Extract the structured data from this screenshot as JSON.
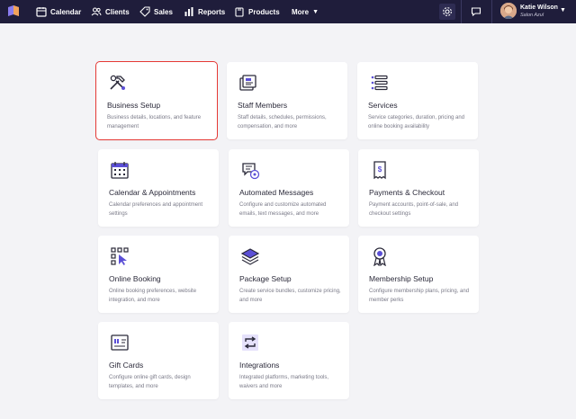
{
  "nav": {
    "calendar": "Calendar",
    "clients": "Clients",
    "sales": "Sales",
    "reports": "Reports",
    "products": "Products",
    "more": "More"
  },
  "user": {
    "name": "Katie Wilson",
    "business": "Salon Azul"
  },
  "colors": {
    "topbar": "#1f1d3b",
    "selected_outline": "#e53935",
    "accent": "#5b4fd6"
  },
  "cards": [
    {
      "title": "Business Setup",
      "desc": "Business details, locations, and feature management",
      "icon": "tools-icon",
      "selected": true
    },
    {
      "title": "Staff Members",
      "desc": "Staff details, schedules, permissions, compensation, and more",
      "icon": "staff-cards-icon"
    },
    {
      "title": "Services",
      "desc": "Service categories, duration, pricing and online booking availability",
      "icon": "list-icon"
    },
    {
      "title": "Calendar & Appointments",
      "desc": "Calendar preferences and appointment settings",
      "icon": "calendar-icon"
    },
    {
      "title": "Automated Messages",
      "desc": "Configure and customize automated emails, text messages, and more",
      "icon": "message-gear-icon"
    },
    {
      "title": "Payments & Checkout",
      "desc": "Payment accounts, point-of-sale, and checkout settings",
      "icon": "receipt-icon"
    },
    {
      "title": "Online Booking",
      "desc": "Online booking preferences, website integration, and more",
      "icon": "cursor-grid-icon"
    },
    {
      "title": "Package Setup",
      "desc": "Create service bundles, customize pricing, and more",
      "icon": "layers-icon"
    },
    {
      "title": "Membership Setup",
      "desc": "Configure membership plans, pricing, and member perks",
      "icon": "badge-icon"
    },
    {
      "title": "Gift Cards",
      "desc": "Configure online gift cards, design templates, and more",
      "icon": "gift-card-icon"
    },
    {
      "title": "Integrations",
      "desc": "Integrated platforms, marketing tools, waivers and more",
      "icon": "integrations-icon"
    }
  ]
}
